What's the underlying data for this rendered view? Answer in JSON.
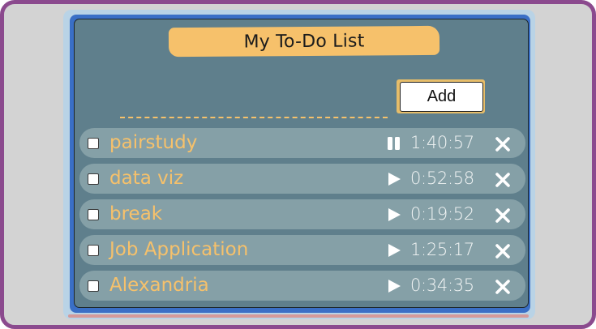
{
  "app": {
    "title": "My To-Do List"
  },
  "form": {
    "input_value": "",
    "input_placeholder": "",
    "add_label": "Add"
  },
  "tasks": [
    {
      "name": "pairstudy",
      "time": "1:40:57",
      "state_icon": "pause-icon",
      "checked": false
    },
    {
      "name": "data viz",
      "time": "0:52:58",
      "state_icon": "play-icon",
      "checked": false
    },
    {
      "name": "break",
      "time": "0:19:52",
      "state_icon": "play-icon",
      "checked": false
    },
    {
      "name": "Job Application",
      "time": "1:25:17",
      "state_icon": "play-icon",
      "checked": false
    },
    {
      "name": "Alexandria",
      "time": "0:34:35",
      "state_icon": "play-icon",
      "checked": false
    }
  ],
  "colors": {
    "frame_border": "#8b4a8e",
    "card_background": "#5f7f8c",
    "row_background": "#85a0a7",
    "accent": "#f6c16b",
    "time_text": "#f2f5f5"
  }
}
